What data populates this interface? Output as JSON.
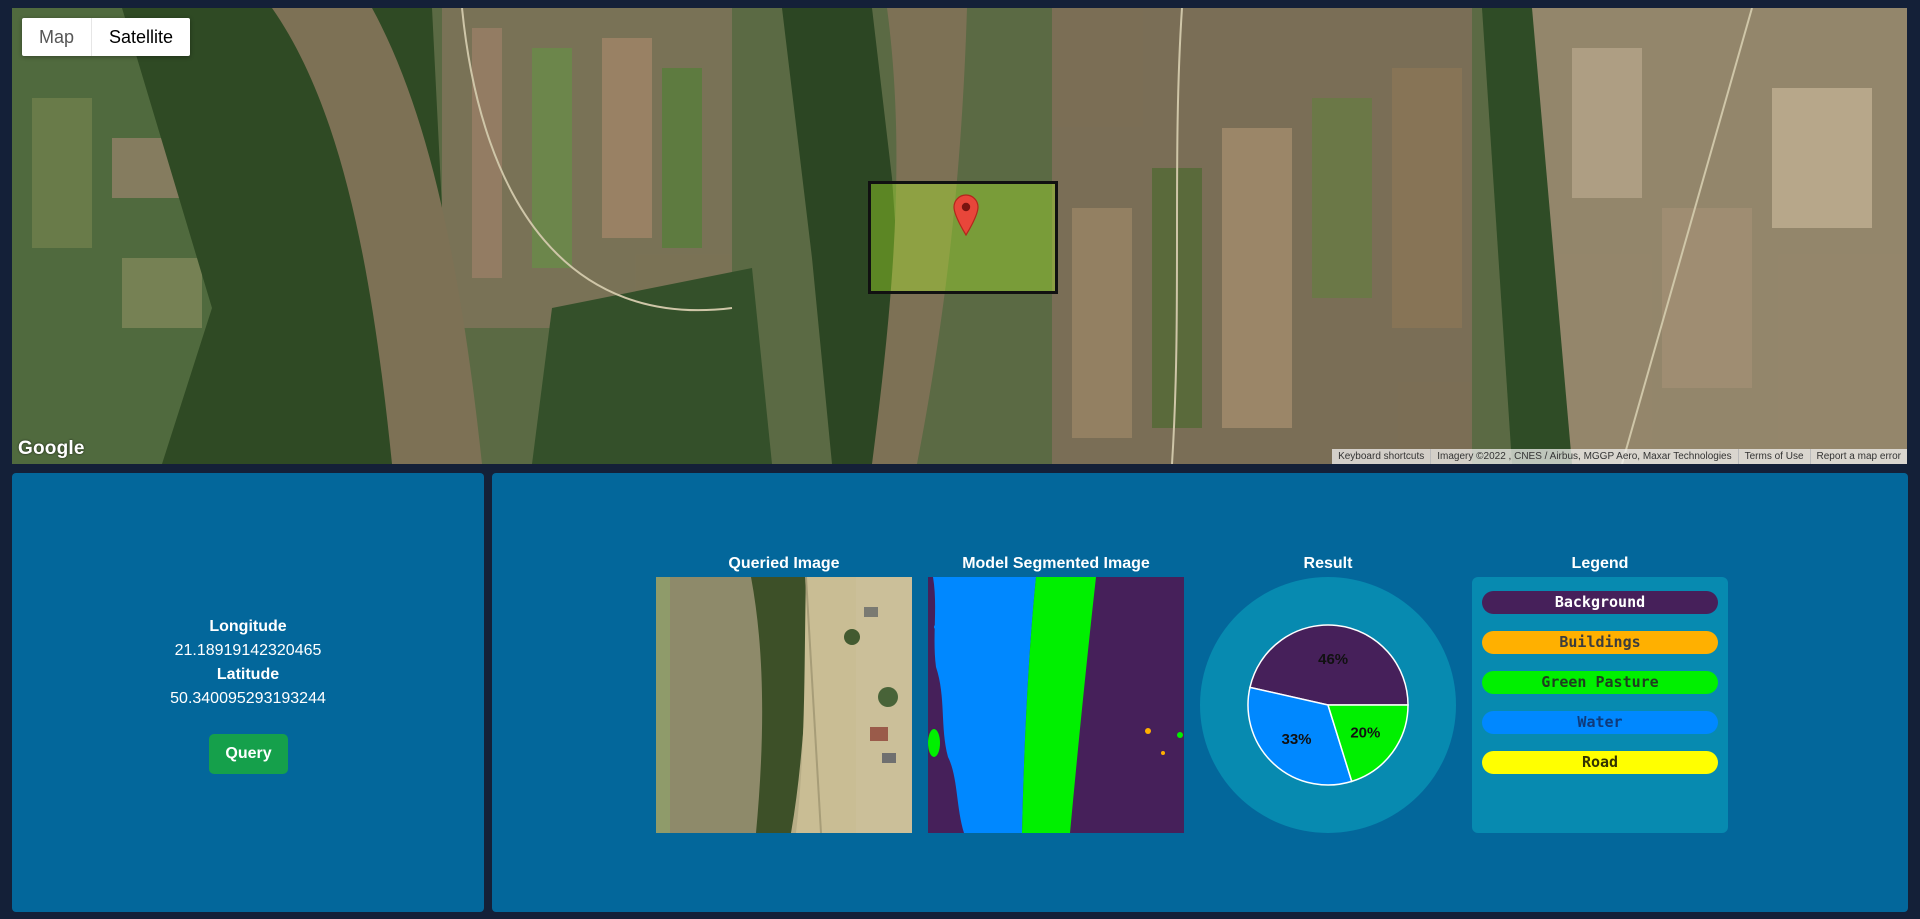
{
  "map": {
    "type_toggle": {
      "map_label": "Map",
      "satellite_label": "Satellite",
      "selected": "Satellite"
    },
    "logo": "Google",
    "attribution": {
      "shortcuts": "Keyboard shortcuts",
      "imagery": "Imagery ©2022 , CNES / Airbus, MGGP Aero, Maxar Technologies",
      "terms": "Terms of Use",
      "report": "Report a map error"
    },
    "marker_icon": "map-pin-icon",
    "selection_color": "#aaf028"
  },
  "coordinates": {
    "longitude_label": "Longitude",
    "longitude_value": "21.18919142320465",
    "latitude_label": "Latitude",
    "latitude_value": "50.340095293193244",
    "query_label": "Query"
  },
  "results": {
    "queried_title": "Queried Image",
    "segmented_title": "Model Segmented Image",
    "result_title": "Result",
    "legend_title": "Legend"
  },
  "legend": [
    {
      "label": "Background",
      "color": "#46205a",
      "text_color": "#ffffff"
    },
    {
      "label": "Buildings",
      "color": "#ffb000",
      "text_color": "#3d3d3d"
    },
    {
      "label": "Green Pasture",
      "color": "#00f000",
      "text_color": "#1f3d1f"
    },
    {
      "label": "Water",
      "color": "#0088ff",
      "text_color": "#0f3a7a"
    },
    {
      "label": "Road",
      "color": "#ffff00",
      "text_color": "#333300"
    }
  ],
  "chart_data": {
    "type": "pie",
    "labels": [
      "Background",
      "Water",
      "Green Pasture"
    ],
    "values": [
      46,
      33,
      20
    ],
    "display_labels": [
      "46%",
      "33%",
      "20%"
    ],
    "colors": [
      "#46205a",
      "#0088ff",
      "#00f000"
    ]
  }
}
